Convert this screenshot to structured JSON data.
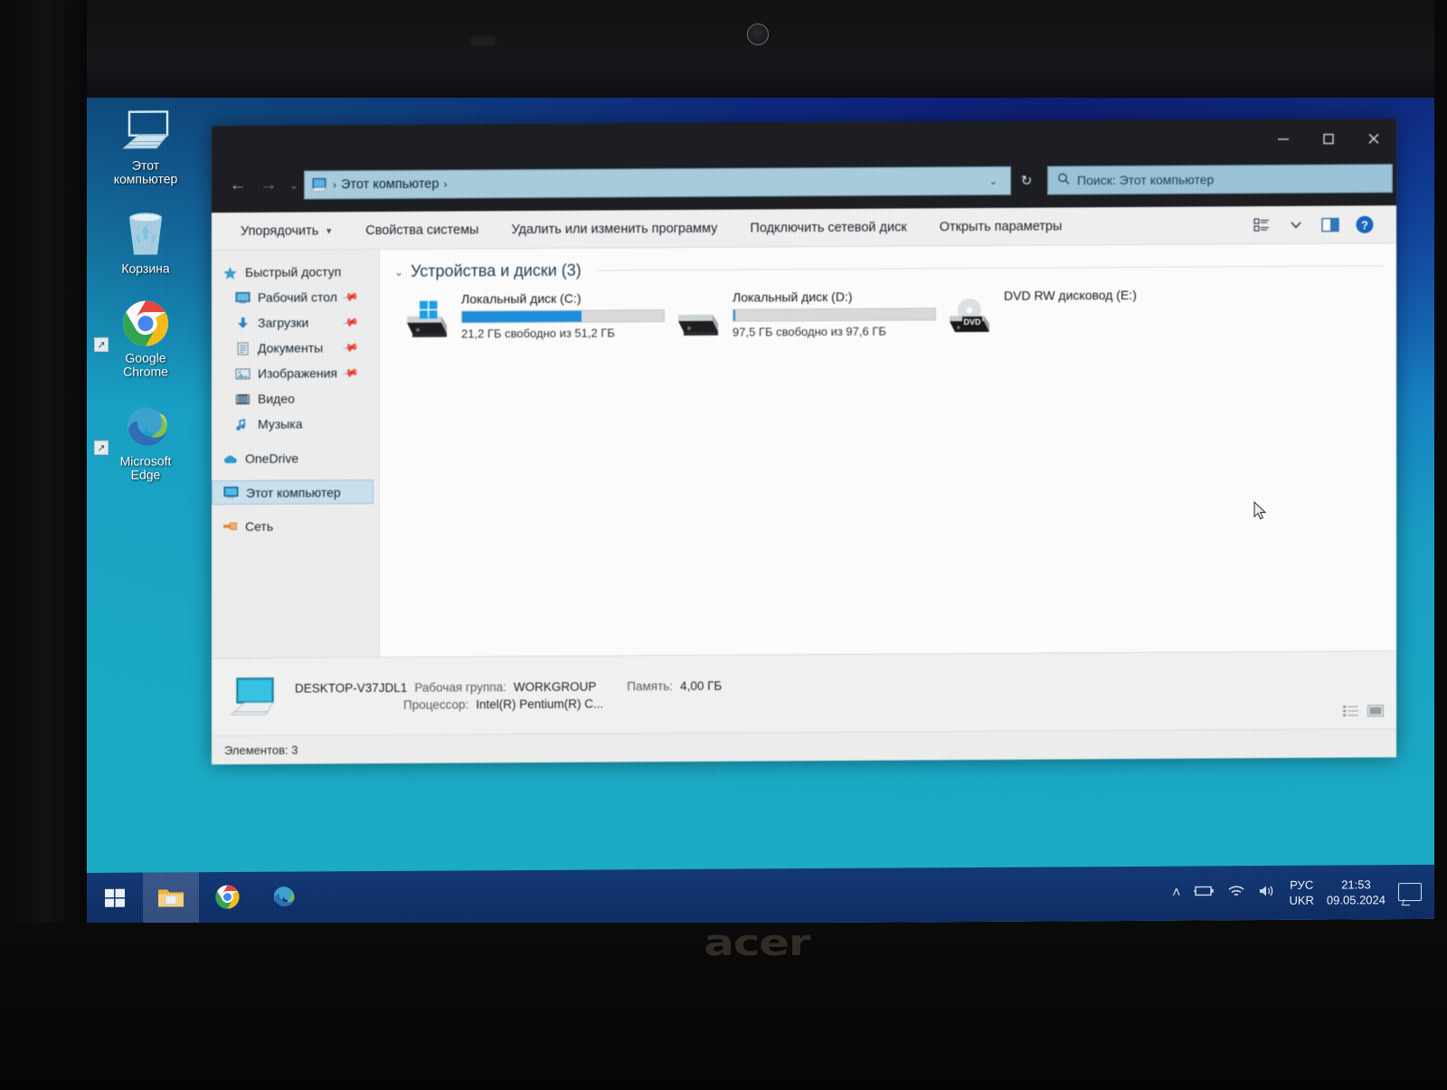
{
  "device": {
    "brand": "acer"
  },
  "desktop": {
    "icons": [
      {
        "name": "this-pc",
        "label": "Этот\nкомпьютер",
        "icon": "monitor-icon",
        "shortcut": false
      },
      {
        "name": "recycle-bin",
        "label": "Корзина",
        "icon": "recycle-bin-icon",
        "shortcut": false
      },
      {
        "name": "google-chrome",
        "label": "Google\nChrome",
        "icon": "chrome-icon",
        "shortcut": true
      },
      {
        "name": "microsoft-edge",
        "label": "Microsoft\nEdge",
        "icon": "edge-icon",
        "shortcut": true
      }
    ]
  },
  "window": {
    "titlebar": {
      "minimize": "—",
      "maximize": "☐",
      "close": "✕"
    },
    "address": {
      "back": "←",
      "forward": "→",
      "up_caret": "⌄",
      "crumb_icon": "this-pc-icon",
      "crumb_text": "Этот компьютер",
      "sep": "›",
      "dropdown": "⌄",
      "refresh": "↻"
    },
    "search": {
      "placeholder": "Поиск: Этот компьютер",
      "icon": "search-icon"
    },
    "commandbar": {
      "items": [
        {
          "name": "organize",
          "label": "Упорядочить",
          "caret": "▼"
        },
        {
          "name": "system-properties",
          "label": "Свойства системы",
          "caret": ""
        },
        {
          "name": "uninstall-change-program",
          "label": "Удалить или изменить программу",
          "caret": ""
        },
        {
          "name": "map-network-drive",
          "label": "Подключить сетевой диск",
          "caret": ""
        },
        {
          "name": "open-settings",
          "label": "Открыть параметры",
          "caret": ""
        }
      ],
      "right_icons": [
        "view-options-icon",
        "chevron-down-icon",
        "preview-pane-icon",
        "help-icon"
      ]
    },
    "navpane": {
      "items": [
        {
          "name": "quick-access",
          "label": "Быстрый доступ",
          "icon": "star-icon",
          "pinned": false,
          "child": false,
          "selected": false
        },
        {
          "name": "desktop",
          "label": "Рабочий стол",
          "icon": "desktop-icon",
          "pinned": true,
          "child": true,
          "selected": false
        },
        {
          "name": "downloads",
          "label": "Загрузки",
          "icon": "download-icon",
          "pinned": true,
          "child": true,
          "selected": false
        },
        {
          "name": "documents",
          "label": "Документы",
          "icon": "document-icon",
          "pinned": true,
          "child": true,
          "selected": false
        },
        {
          "name": "pictures",
          "label": "Изображения",
          "icon": "picture-icon",
          "pinned": true,
          "child": true,
          "selected": false
        },
        {
          "name": "videos",
          "label": "Видео",
          "icon": "video-icon",
          "pinned": false,
          "child": true,
          "selected": false
        },
        {
          "name": "music",
          "label": "Музыка",
          "icon": "music-icon",
          "pinned": false,
          "child": true,
          "selected": false
        },
        {
          "name": "onedrive",
          "label": "OneDrive",
          "icon": "cloud-icon",
          "pinned": false,
          "child": false,
          "selected": false
        },
        {
          "name": "this-pc",
          "label": "Этот компьютер",
          "icon": "this-pc-icon",
          "pinned": false,
          "child": false,
          "selected": true
        },
        {
          "name": "network",
          "label": "Сеть",
          "icon": "network-icon",
          "pinned": false,
          "child": false,
          "selected": false
        }
      ]
    },
    "content": {
      "group_header": "Устройства и диски (3)",
      "group_chevron": "⌄",
      "drives": [
        {
          "name": "local-disk-c",
          "label": "Локальный диск (C:)",
          "icon": "windows-drive-icon",
          "free_text": "21,2 ГБ свободно из 51,2 ГБ",
          "free_gb": 21.2,
          "total_gb": 51.2,
          "used_percent": 59,
          "bar_color": "#1a8fe0",
          "has_bar": true
        },
        {
          "name": "local-disk-d",
          "label": "Локальный диск (D:)",
          "icon": "drive-icon",
          "free_text": "97,5 ГБ свободно из 97,6 ГБ",
          "free_gb": 97.5,
          "total_gb": 97.6,
          "used_percent": 0,
          "bar_color": "#1a8fe0",
          "has_bar": true
        },
        {
          "name": "dvd-rw-drive-e",
          "label": "DVD RW дисковод (E:)",
          "icon": "dvd-drive-icon",
          "free_text": "",
          "free_gb": null,
          "total_gb": null,
          "used_percent": 0,
          "bar_color": "#1a8fe0",
          "has_bar": false
        }
      ]
    },
    "details": {
      "icon": "computer-icon",
      "computer_name": "DESKTOP-V37JDL1",
      "rows": [
        {
          "key": "Рабочая группа:",
          "value": "WORKGROUP"
        },
        {
          "key": "Процессор:",
          "value": "Intel(R) Pentium(R) C..."
        }
      ],
      "memory_key": "Память:",
      "memory_value": "4,00 ГБ",
      "view_icons": [
        "details-view-icon",
        "large-icons-view-icon"
      ]
    },
    "statusbar": {
      "items_text": "Элементов: 3"
    }
  },
  "taskbar": {
    "buttons": [
      {
        "name": "start-button",
        "icon": "windows-logo-icon",
        "active": false
      },
      {
        "name": "file-explorer-button",
        "icon": "folder-icon",
        "active": true
      },
      {
        "name": "chrome-button",
        "icon": "chrome-icon",
        "active": false
      },
      {
        "name": "edge-button",
        "icon": "edge-icon",
        "active": false
      }
    ],
    "tray": {
      "overflow": "˄",
      "icons": [
        "battery-icon",
        "wifi-icon",
        "volume-icon"
      ],
      "lang_top": "РУС",
      "lang_bottom": "UKR",
      "time": "21:53",
      "date": "09.05.2024",
      "action_center": "notifications-icon"
    }
  },
  "colors": {
    "accent_blue": "#1a8fe0",
    "desktop_cyan": "#1aadc7",
    "desktop_blue": "#1348c9",
    "titlebar": "#1c1d21",
    "address_field": "#a9cde0",
    "selection": "#cce2f0"
  }
}
